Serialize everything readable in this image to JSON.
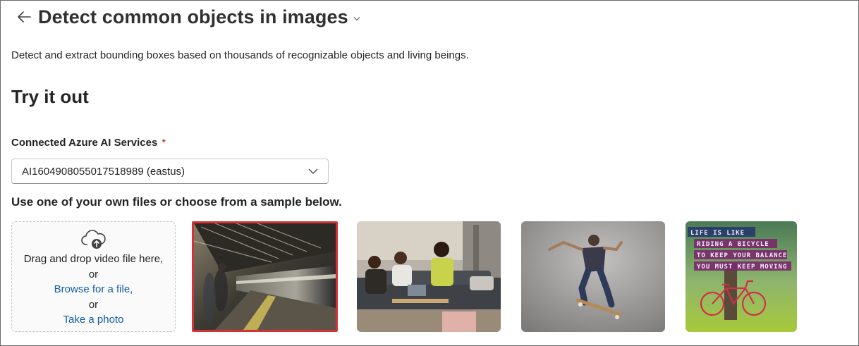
{
  "header": {
    "title": "Detect common objects in images",
    "back_icon": "arrow-left-icon",
    "title_menu_icon": "chevron-down-icon"
  },
  "description": "Detect and extract bounding boxes based on thousands of recognizable objects and living beings.",
  "try_it_out": "Try it out",
  "service": {
    "label": "Connected Azure AI Services",
    "required_marker": "*",
    "selected_value": "AI1604908055017518989 (eastus)"
  },
  "samples": {
    "instruction": "Use one of your own files or choose from a sample below.",
    "dropzone": {
      "icon": "cloud-upload-icon",
      "line1": "Drag and drop video file here,",
      "or1": "or",
      "browse_link": "Browse for a file,",
      "or2": "or",
      "photo_link": "Take a photo"
    },
    "poster_lines": [
      "LIFE IS LIKE",
      "RIDING A BICYCLE",
      "TO KEEP YOUR BALANCE",
      "YOU MUST KEEP MOVING"
    ]
  },
  "colors": {
    "accent_link": "#115ea3",
    "selected_border": "#d13438",
    "required": "#c50f1f"
  }
}
